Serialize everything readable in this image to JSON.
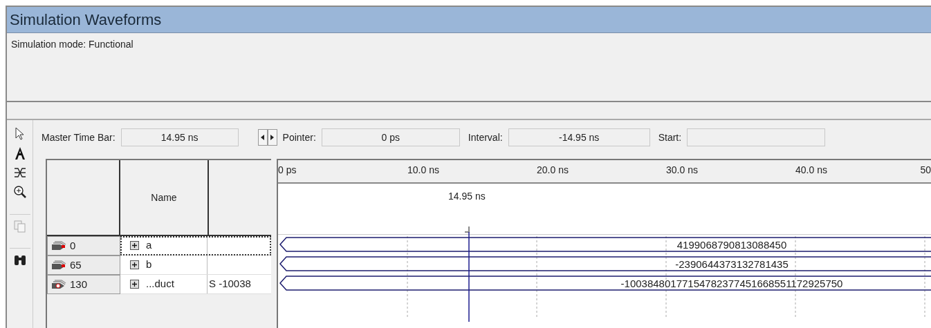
{
  "window": {
    "title": "Simulation Waveforms"
  },
  "mode_text": "Simulation mode: Functional",
  "time_bar": {
    "master_label": "Master Time Bar:",
    "master_value": "14.95 ns",
    "pointer_label": "Pointer:",
    "pointer_value": "0 ps",
    "interval_label": "Interval:",
    "interval_value": "-14.95 ns",
    "start_label": "Start:"
  },
  "table": {
    "name_header": "Name",
    "rows": [
      {
        "index": "0",
        "kind": "input",
        "name": "a",
        "waveform": "4199068790813088450",
        "selected": true
      },
      {
        "index": "65",
        "kind": "input",
        "name": "b",
        "waveform": "-2390644373132781435",
        "selected": false
      },
      {
        "index": "130",
        "kind": "output",
        "name": "...duct",
        "value": "S -10038",
        "waveform": "-10038480177154782377451668551172925750",
        "selected": false
      }
    ]
  },
  "ruler": {
    "ticks": [
      "0 ps",
      "10.0 ns",
      "20.0 ns",
      "30.0 ns",
      "40.0 ns",
      "50"
    ],
    "cursor_label": "14.95 ns"
  }
}
